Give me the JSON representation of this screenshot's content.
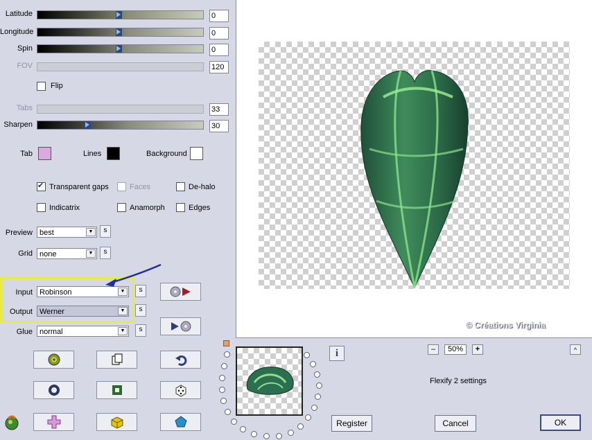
{
  "sliders": [
    {
      "label": "Latitude",
      "value": "0",
      "pos": 0.49
    },
    {
      "label": "Longitude",
      "value": "0",
      "pos": 0.49
    },
    {
      "label": "Spin",
      "value": "0",
      "pos": 0.49
    },
    {
      "label": "FOV",
      "value": "120"
    },
    {
      "label": "Tabs",
      "value": "33"
    },
    {
      "label": "Sharpen",
      "value": "30",
      "pos": 0.3
    }
  ],
  "flip": {
    "label": "Flip"
  },
  "colors": {
    "tab_label": "Tab",
    "tab_color": "#dba8e0",
    "lines_label": "Lines",
    "lines_color": "#000000",
    "background_label": "Background",
    "background_color": "#ffffff"
  },
  "options": {
    "transparent_gaps": "Transparent gaps",
    "faces": "Faces",
    "de_halo": "De-halo",
    "indicatrix": "Indicatrix",
    "anamorph": "Anamorph",
    "edges": "Edges"
  },
  "dropdowns": {
    "preview": {
      "label": "Preview",
      "value": "best"
    },
    "grid": {
      "label": "Grid",
      "value": "none"
    },
    "input": {
      "label": "Input",
      "value": "Robinson"
    },
    "output": {
      "label": "Output",
      "value": "Werner"
    },
    "glue": {
      "label": "Glue",
      "value": "normal"
    }
  },
  "s_label": "s",
  "zoom": {
    "minus": "–",
    "value": "50%",
    "plus": "+",
    "caret": "^"
  },
  "info_icon": "i",
  "settings_text": "Flexify 2 settings",
  "watermark": "© Créations Virginia",
  "buttons": {
    "register": "Register",
    "cancel": "Cancel",
    "ok": "OK"
  },
  "accent": {
    "highlight": "#e9ec3a",
    "arrow": "#1c2f9c"
  }
}
